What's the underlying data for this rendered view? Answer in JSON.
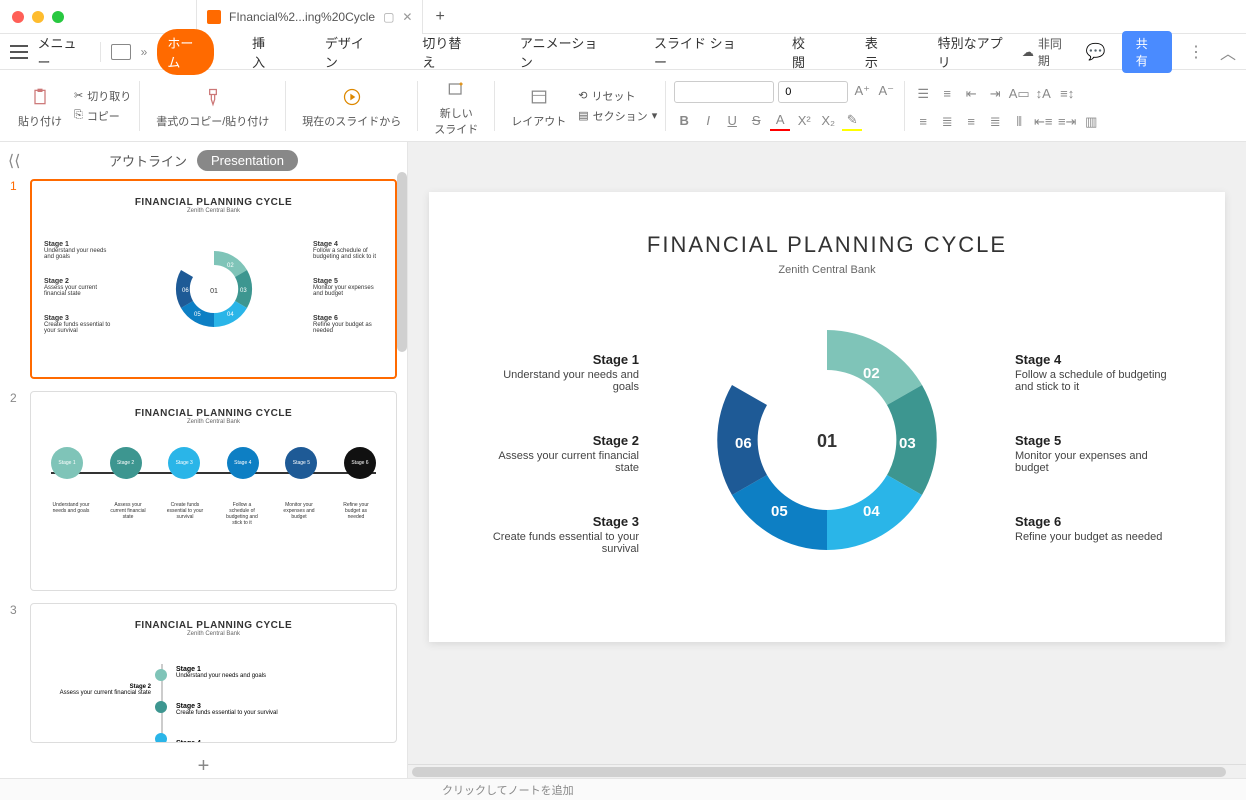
{
  "window": {
    "tab_title": "FInancial%2...ing%20Cycle"
  },
  "menu": {
    "label": "メニュー",
    "tabs": [
      "ホーム",
      "挿入",
      "デザイン",
      "切り替え",
      "アニメーション",
      "スライド ショー",
      "校閲",
      "表示",
      "特別なアプリ"
    ],
    "sync": "非同期",
    "share": "共有"
  },
  "ribbon": {
    "paste": "貼り付け",
    "cut": "切り取り",
    "copy": "コピー",
    "format_painter": "書式のコピー/貼り付け",
    "from_current": "現在のスライドから",
    "new_slide": "新しい\nスライド",
    "layout": "レイアウト",
    "reset": "リセット",
    "section": "セクション",
    "font_size": "0"
  },
  "sidebar": {
    "outline": "アウトライン",
    "presentation": "Presentation"
  },
  "slide": {
    "title": "FINANCIAL PLANNING CYCLE",
    "subtitle": "Zenith Central Bank",
    "stages_left": [
      {
        "h": "Stage 1",
        "t": "Understand your needs and goals"
      },
      {
        "h": "Stage 2",
        "t": "Assess your current financial state"
      },
      {
        "h": "Stage 3",
        "t": "Create funds essential to your survival"
      }
    ],
    "stages_right": [
      {
        "h": "Stage 4",
        "t": "Follow a schedule of budgeting and stick to it"
      },
      {
        "h": "Stage 5",
        "t": "Monitor your expenses and budget"
      },
      {
        "h": "Stage 6",
        "t": "Refine your budget as needed"
      }
    ],
    "segments": [
      "01",
      "02",
      "03",
      "04",
      "05",
      "06"
    ],
    "colors": [
      "#ffffff",
      "#7fc4b8",
      "#3d9690",
      "#2ab5e8",
      "#0d7fc4",
      "#1e5a96"
    ]
  },
  "chart_data": {
    "type": "pie",
    "title": "FINANCIAL PLANNING CYCLE",
    "categories": [
      "Stage 1",
      "Stage 2",
      "Stage 3",
      "Stage 4",
      "Stage 5",
      "Stage 6"
    ],
    "values": [
      1,
      1,
      1,
      1,
      1,
      1
    ],
    "annotations": [
      "Understand your needs and goals",
      "Assess your current financial state",
      "Create funds essential to your survival",
      "Follow a schedule of budgeting and stick to it",
      "Monitor your expenses and budget",
      "Refine your budget as needed"
    ]
  },
  "status": {
    "notes": "クリックしてノートを追加"
  }
}
